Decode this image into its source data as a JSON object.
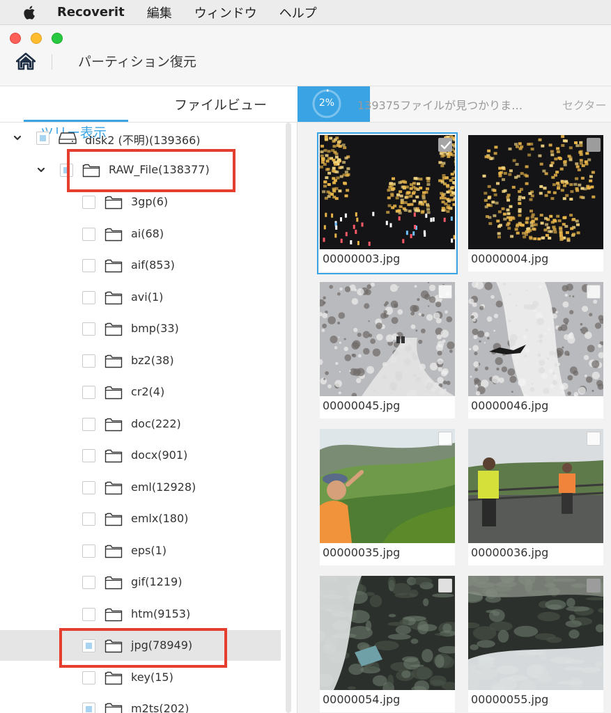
{
  "menubar": {
    "apple": "apple-icon",
    "app": "Recoverit",
    "items": [
      "編集",
      "ウィンドウ",
      "ヘルプ"
    ]
  },
  "titlebar": {
    "title": "パーティション復元",
    "home_icon": "home-icon"
  },
  "left_panel": {
    "tabs": {
      "tree": "ツリー表示",
      "file": "ファイルビュー",
      "active": "tree"
    },
    "root": {
      "label": "disk2 (不明)(139366)",
      "state": "partial"
    },
    "raw": {
      "label": "RAW_File(138377)",
      "state": "partial"
    },
    "items": [
      {
        "label": "3gp(6)",
        "state": "unchecked"
      },
      {
        "label": "ai(68)",
        "state": "unchecked"
      },
      {
        "label": "aif(853)",
        "state": "unchecked"
      },
      {
        "label": "avi(1)",
        "state": "unchecked"
      },
      {
        "label": "bmp(33)",
        "state": "unchecked"
      },
      {
        "label": "bz2(38)",
        "state": "unchecked"
      },
      {
        "label": "cr2(4)",
        "state": "unchecked"
      },
      {
        "label": "doc(222)",
        "state": "unchecked"
      },
      {
        "label": "docx(901)",
        "state": "unchecked"
      },
      {
        "label": "eml(12928)",
        "state": "unchecked"
      },
      {
        "label": "emlx(180)",
        "state": "unchecked"
      },
      {
        "label": "eps(1)",
        "state": "unchecked"
      },
      {
        "label": "gif(1219)",
        "state": "unchecked"
      },
      {
        "label": "htm(9153)",
        "state": "unchecked"
      },
      {
        "label": "jpg(78949)",
        "state": "partial",
        "selected": true
      },
      {
        "label": "key(15)",
        "state": "unchecked"
      },
      {
        "label": "m2ts(202)",
        "state": "partial"
      }
    ]
  },
  "status": {
    "progress_percent": 2,
    "progress_label": "2%",
    "found_text": "139375ファイルが見つかりま…",
    "sector_text": "セクター"
  },
  "files": [
    {
      "name": "00000003.jpg",
      "selected": true,
      "checked": true,
      "scene": "night-city"
    },
    {
      "name": "00000004.jpg",
      "selected": false,
      "checked": false,
      "scene": "night-city-2"
    },
    {
      "name": "00000045.jpg",
      "selected": false,
      "checked": false,
      "scene": "snow-trail"
    },
    {
      "name": "00000046.jpg",
      "selected": false,
      "checked": false,
      "scene": "snow-waterfall"
    },
    {
      "name": "00000035.jpg",
      "selected": false,
      "checked": false,
      "scene": "green-hills"
    },
    {
      "name": "00000036.jpg",
      "selected": false,
      "checked": false,
      "scene": "hikers"
    },
    {
      "name": "00000054.jpg",
      "selected": false,
      "checked": false,
      "scene": "cave"
    },
    {
      "name": "00000055.jpg",
      "selected": false,
      "checked": false,
      "scene": "cave-water"
    }
  ],
  "colors": {
    "accent": "#3aa3e3",
    "highlight_box": "#e53d2e",
    "selected_row": "#e5e5e5"
  }
}
